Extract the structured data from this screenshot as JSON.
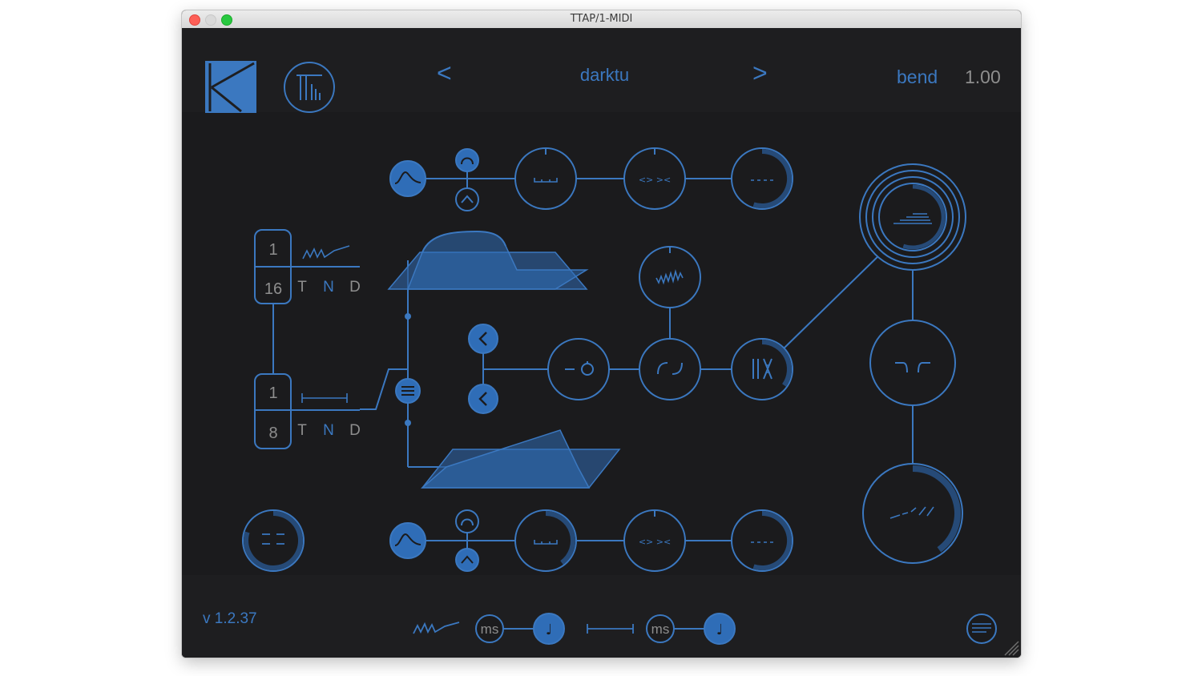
{
  "window": {
    "title": "TTAP/1-MIDI"
  },
  "header": {
    "prev_label": "<",
    "preset_name": "darktu",
    "next_label": ">",
    "param_name": "bend",
    "param_value": "1.00"
  },
  "left_column": {
    "top_division": {
      "numerator": "1",
      "denominator": "16",
      "modes": [
        "T",
        "N",
        "D"
      ]
    },
    "bottom_division": {
      "numerator": "1",
      "denominator": "8",
      "modes": [
        "T",
        "N",
        "D"
      ]
    }
  },
  "footer": {
    "version": "v 1.2.37",
    "time_mode_1": {
      "unit_label": "ms",
      "note_glyph": "♩"
    },
    "time_mode_2": {
      "unit_label": "ms",
      "note_glyph": "♩"
    }
  },
  "colors": {
    "accent": "#3b78c0",
    "accent_fill": "#2f6db7",
    "dark_ring": "#264a77",
    "background": "#1b1b1d",
    "panel": "#1e1e20",
    "text_grey": "#8e8e8e"
  },
  "knob_values": {
    "top_row_feedback": 0.55,
    "bottom_row_feedback": 0.55,
    "bottom_row_time": 0.4,
    "stereo_width": 0.35,
    "mix": 0.4,
    "output_level": 0.8,
    "output_meter": 0.55
  }
}
